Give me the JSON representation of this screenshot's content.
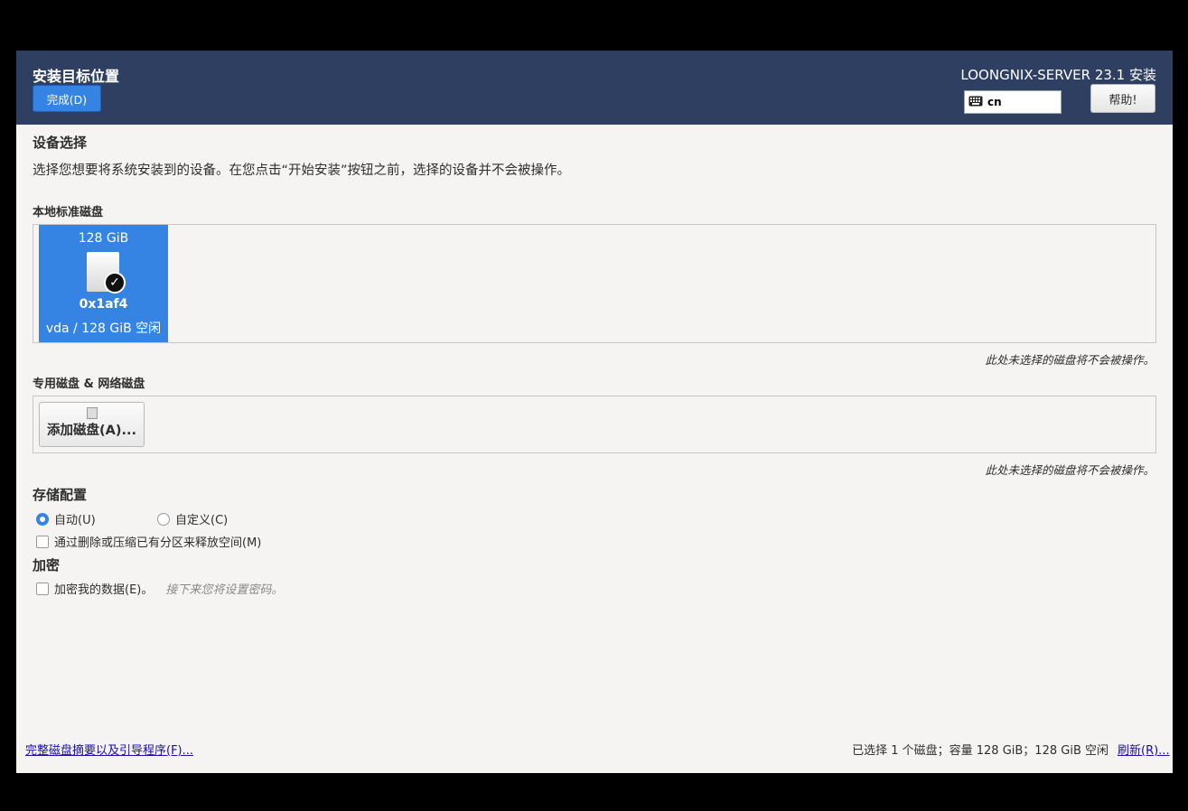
{
  "header": {
    "title": "安装目标位置",
    "done_label": "完成(D)",
    "product": "LOONGNIX-SERVER 23.1 安装",
    "keyboard_layout": "cn",
    "help_label": "帮助!"
  },
  "device_selection": {
    "title": "设备选择",
    "description": "选择您想要将系统安装到的设备。在您点击“开始安装”按钮之前，选择的设备并不会被操作。"
  },
  "local_disks": {
    "label": "本地标准磁盘",
    "disks": [
      {
        "size": "128 GiB",
        "model": "0x1af4",
        "info": "vda / 128 GiB 空闲",
        "selected": true
      }
    ],
    "note": "此处未选择的磁盘将不会被操作。"
  },
  "special_disks": {
    "label": "专用磁盘 & 网络磁盘",
    "add_label": "添加磁盘(A)...",
    "note": "此处未选择的磁盘将不会被操作。"
  },
  "storage": {
    "title": "存储配置",
    "auto_label": "自动(U)",
    "custom_label": "自定义(C)",
    "selected": "auto",
    "reclaim_label": "通过删除或压缩已有分区来释放空间(M)"
  },
  "encryption": {
    "title": "加密",
    "encrypt_label": "加密我的数据(E)。",
    "hint": "接下来您将设置密码。"
  },
  "footer": {
    "summary_link": "完整磁盘摘要以及引导程序(F)...",
    "status": "已选择 1 个磁盘；容量 128 GiB；128 GiB 空闲",
    "refresh_link": "刷新(R)..."
  },
  "colors": {
    "header_bg": "#2f3f61",
    "accent": "#3584e4",
    "window_bg": "#f5f4f2"
  }
}
